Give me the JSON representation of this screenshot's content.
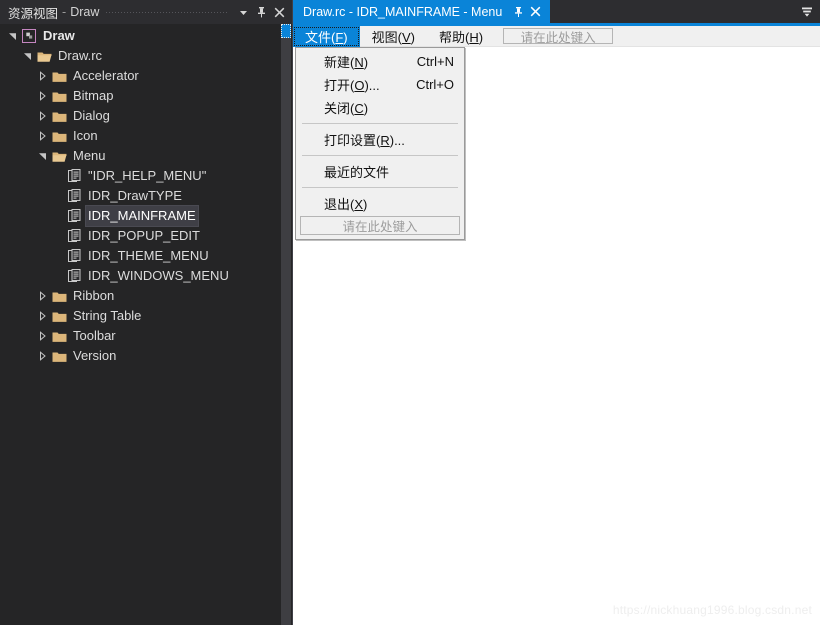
{
  "colors": {
    "accent_blue": "#0a84d8",
    "sidebar_bg": "#252526",
    "panel_header_bg": "#2d2d30",
    "tree_text": "#dcdcdc",
    "folder_icon": "#dcb67a",
    "project_icon": "#c586c0",
    "menu_bg": "#f0f0f0",
    "editor_bg": "#ffffff"
  },
  "sidebar": {
    "header": {
      "title_cn": "资源视图",
      "separator": "-",
      "title_en": "Draw",
      "dropdown_icon": "chevron-down-icon",
      "pin_icon": "pin-icon",
      "close_icon": "close-icon"
    },
    "tree": [
      {
        "label": "Draw",
        "indent": 0,
        "icon": "project-icon",
        "state": "expanded",
        "bold": true,
        "selected": false
      },
      {
        "label": "Draw.rc",
        "indent": 1,
        "icon": "folder-open-icon",
        "state": "expanded",
        "bold": false,
        "selected": false
      },
      {
        "label": "Accelerator",
        "indent": 2,
        "icon": "folder-icon",
        "state": "collapsed",
        "bold": false,
        "selected": false
      },
      {
        "label": "Bitmap",
        "indent": 2,
        "icon": "folder-icon",
        "state": "collapsed",
        "bold": false,
        "selected": false
      },
      {
        "label": "Dialog",
        "indent": 2,
        "icon": "folder-icon",
        "state": "collapsed",
        "bold": false,
        "selected": false
      },
      {
        "label": "Icon",
        "indent": 2,
        "icon": "folder-icon",
        "state": "collapsed",
        "bold": false,
        "selected": false
      },
      {
        "label": "Menu",
        "indent": 2,
        "icon": "folder-open-icon",
        "state": "expanded",
        "bold": false,
        "selected": false
      },
      {
        "label": "\"IDR_HELP_MENU\"",
        "indent": 3,
        "icon": "resource-icon",
        "state": "leaf",
        "bold": false,
        "selected": false
      },
      {
        "label": "IDR_DrawTYPE",
        "indent": 3,
        "icon": "resource-icon",
        "state": "leaf",
        "bold": false,
        "selected": false
      },
      {
        "label": "IDR_MAINFRAME",
        "indent": 3,
        "icon": "resource-icon",
        "state": "leaf",
        "bold": false,
        "selected": true
      },
      {
        "label": "IDR_POPUP_EDIT",
        "indent": 3,
        "icon": "resource-icon",
        "state": "leaf",
        "bold": false,
        "selected": false
      },
      {
        "label": "IDR_THEME_MENU",
        "indent": 3,
        "icon": "resource-icon",
        "state": "leaf",
        "bold": false,
        "selected": false
      },
      {
        "label": "IDR_WINDOWS_MENU",
        "indent": 3,
        "icon": "resource-icon",
        "state": "leaf",
        "bold": false,
        "selected": false
      },
      {
        "label": "Ribbon",
        "indent": 2,
        "icon": "folder-icon",
        "state": "collapsed",
        "bold": false,
        "selected": false
      },
      {
        "label": "String Table",
        "indent": 2,
        "icon": "folder-icon",
        "state": "collapsed",
        "bold": false,
        "selected": false
      },
      {
        "label": "Toolbar",
        "indent": 2,
        "icon": "folder-icon",
        "state": "collapsed",
        "bold": false,
        "selected": false
      },
      {
        "label": "Version",
        "indent": 2,
        "icon": "folder-icon",
        "state": "collapsed",
        "bold": false,
        "selected": false
      }
    ]
  },
  "editor": {
    "tab": {
      "title": "Draw.rc - IDR_MAINFRAME - Menu",
      "pin_icon": "pin-icon",
      "close_icon": "close-icon",
      "overflow_icon": "tab-overflow-icon"
    },
    "menubar": {
      "items": [
        {
          "label": "文件(F)",
          "mnemonic": "F",
          "active": true
        },
        {
          "label": "视图(V)",
          "mnemonic": "V",
          "active": false
        },
        {
          "label": "帮助(H)",
          "mnemonic": "H",
          "active": false
        }
      ],
      "new_item_placeholder": "请在此处键入"
    },
    "dropdown": {
      "owner": "文件(F)",
      "items": [
        {
          "type": "item",
          "label": "新建(N)",
          "mnemonic": "N",
          "accel": "Ctrl+N"
        },
        {
          "type": "item",
          "label": "打开(O)...",
          "mnemonic": "O",
          "accel": "Ctrl+O"
        },
        {
          "type": "item",
          "label": "关闭(C)",
          "mnemonic": "C",
          "accel": ""
        },
        {
          "type": "separator"
        },
        {
          "type": "item",
          "label": "打印设置(R)...",
          "mnemonic": "R",
          "accel": ""
        },
        {
          "type": "separator"
        },
        {
          "type": "item",
          "label": "最近的文件",
          "mnemonic": "",
          "accel": ""
        },
        {
          "type": "separator"
        },
        {
          "type": "item",
          "label": "退出(X)",
          "mnemonic": "X",
          "accel": ""
        }
      ],
      "new_item_placeholder": "请在此处键入"
    }
  },
  "watermark": {
    "text": "https://nickhuang1996.blog.csdn.net"
  }
}
